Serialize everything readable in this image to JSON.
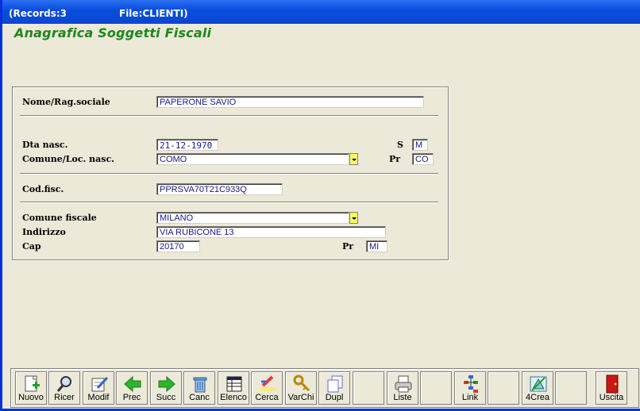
{
  "titlebar": {
    "records": "(Records:3",
    "file": "File:CLIENTI)"
  },
  "header": {
    "title": "Anagrafica Soggetti Fiscali"
  },
  "form": {
    "nome_label": "Nome/Rag.sociale",
    "nome_value": "PAPERONE SAVIO",
    "dta_label": "Dta nasc.",
    "dta_value": "21-12-1970",
    "sesso_label": "S",
    "sesso_value": "M",
    "comune_nasc_label": "Comune/Loc. nasc.",
    "comune_nasc_value": "COMO",
    "pr_nasc_label": "Pr",
    "pr_nasc_value": "CO",
    "codfisc_label": "Cod.fisc.",
    "codfisc_value": "PPRSVA70T21C933Q",
    "comune_fisc_label": "Comune fiscale",
    "comune_fisc_value": "MILANO",
    "indirizzo_label": "Indirizzo",
    "indirizzo_value": "VIA RUBICONE 13",
    "cap_label": "Cap",
    "cap_value": "20170",
    "pr_fisc_label": "Pr",
    "pr_fisc_value": "MI"
  },
  "toolbar": {
    "buttons": [
      {
        "label": "Nuovo",
        "icon": "new-document-icon"
      },
      {
        "label": "Ricer",
        "icon": "search-icon"
      },
      {
        "label": "Modif",
        "icon": "edit-icon"
      },
      {
        "label": "Prec",
        "icon": "arrow-left-icon"
      },
      {
        "label": "Succ",
        "icon": "arrow-right-icon"
      },
      {
        "label": "Canc",
        "icon": "trash-icon"
      },
      {
        "label": "Elenco",
        "icon": "list-icon"
      },
      {
        "label": "Cerca",
        "icon": "highlight-icon"
      },
      {
        "label": "VarChi",
        "icon": "keys-icon"
      },
      {
        "label": "Dupl",
        "icon": "duplicate-icon"
      },
      {
        "label": "",
        "icon": ""
      },
      {
        "label": "Liste",
        "icon": "printer-icon"
      },
      {
        "label": "",
        "icon": ""
      },
      {
        "label": "Link",
        "icon": "link-icon"
      },
      {
        "label": "",
        "icon": ""
      },
      {
        "label": "4Crea",
        "icon": "create-icon"
      },
      {
        "label": "",
        "icon": ""
      },
      {
        "label": "Uscita",
        "icon": "exit-door-icon"
      }
    ]
  },
  "colors": {
    "title_green": "#1a8a1a",
    "field_text": "#1a1a8c",
    "dropdown_yellow": "#ffff66",
    "titlebar_blue": "#0a4ee0"
  }
}
